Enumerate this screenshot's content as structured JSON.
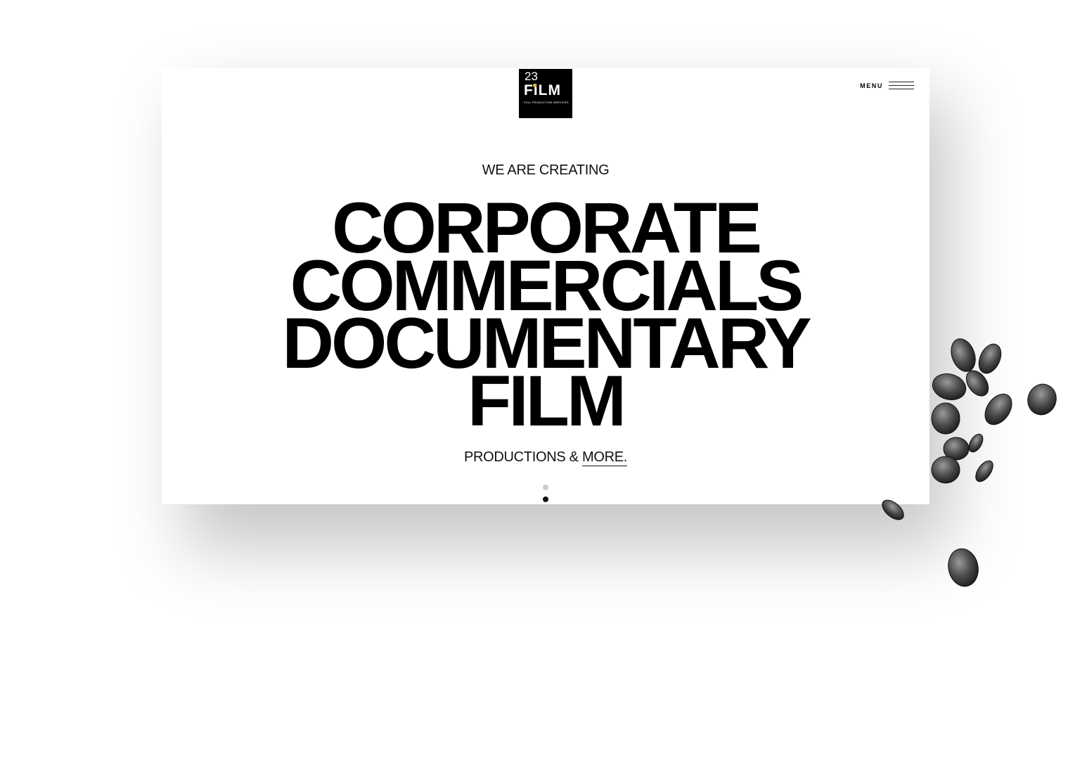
{
  "logo": {
    "number": "23",
    "word": "FiLM",
    "tagline": "FULL PRODUCTION SERVICES"
  },
  "header": {
    "menu_label": "MENU"
  },
  "hero": {
    "eyebrow": "WE ARE CREATING",
    "lines": [
      "CORPORATE",
      "COMMERCIALS",
      "DOCUMENTARY",
      "FILM"
    ],
    "tagline_prefix": "PRODUCTIONS & ",
    "tagline_link": "MORE."
  },
  "pager": {
    "slides": 2,
    "active_index": 1,
    "inactive_color": "#cccccc",
    "active_color": "#111111"
  },
  "colors": {
    "logo_accent": "#e8c32a",
    "text": "#000000",
    "background": "#ffffff"
  },
  "decorations": {
    "leaves_icon": "leaves-decoration-icon"
  }
}
